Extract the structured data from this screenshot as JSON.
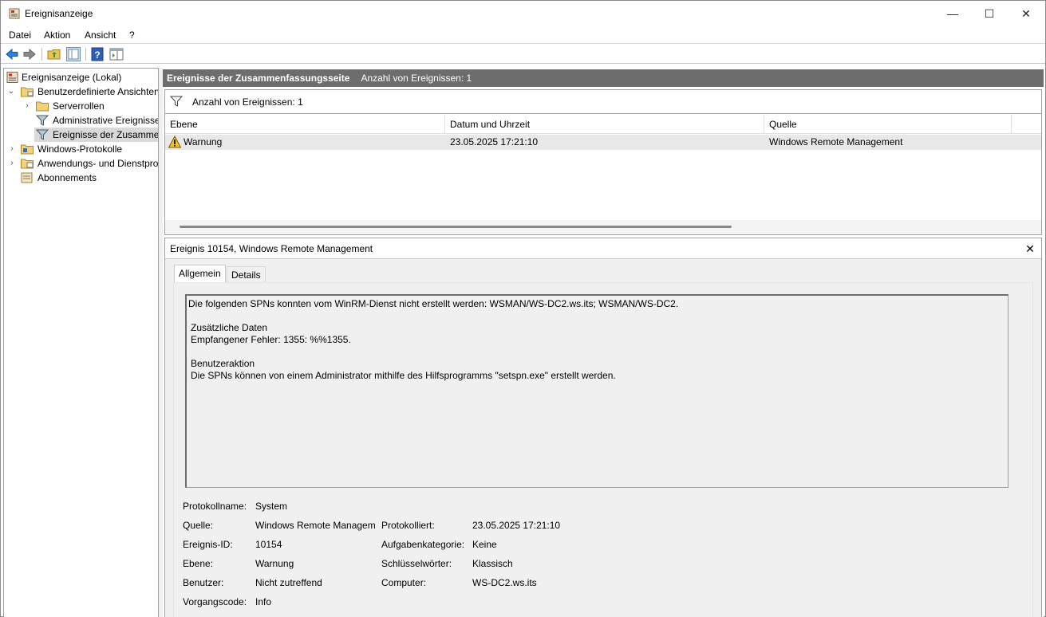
{
  "window": {
    "title": "Ereignisanzeige",
    "controls": {
      "minimize": "—",
      "maximize": "☐",
      "close": "✕"
    }
  },
  "menu": [
    "Datei",
    "Aktion",
    "Ansicht",
    "?"
  ],
  "toolbar": {
    "icons": [
      "back-arrow-icon",
      "forward-arrow-icon",
      "folder-up-icon",
      "show-hide-tree-icon",
      "help-icon",
      "show-action-pane-icon"
    ]
  },
  "tree": {
    "items": [
      {
        "label": "Ereignisanzeige (Lokal)"
      },
      {
        "label": "Benutzerdefinierte Ansichten"
      },
      {
        "label": "Serverrollen"
      },
      {
        "label": "Administrative Ereignisse"
      },
      {
        "label": "Ereignisse der Zusammenfassungsseite"
      },
      {
        "label": "Windows-Protokolle"
      },
      {
        "label": "Anwendungs- und Dienstprotokolle"
      },
      {
        "label": "Abonnements"
      }
    ]
  },
  "summary": {
    "title": "Ereignisse der Zusammenfassungsseite",
    "count": "Anzahl von Ereignissen: 1"
  },
  "filter": {
    "text": "Anzahl von Ereignissen: 1"
  },
  "grid": {
    "columns": [
      "Ebene",
      "Datum und Uhrzeit",
      "Quelle"
    ],
    "rows": [
      {
        "level": "Warnung",
        "datetime": "23.05.2025 17:21:10",
        "source": "Windows Remote Management"
      }
    ]
  },
  "detail": {
    "title": "Ereignis 10154, Windows Remote Management",
    "close": "✕",
    "tabs": [
      "Allgemein",
      "Details"
    ],
    "message": {
      "line1": "Die folgenden SPNs konnten vom WinRM-Dienst nicht erstellt werden: WSMAN/WS-DC2.ws.its; WSMAN/WS-DC2.",
      "line3": "Zusätzliche Daten",
      "line4": "Empfangener Fehler: 1355: %%1355.",
      "line6": "Benutzeraktion",
      "line7": "Die SPNs können von einem Administrator mithilfe des Hilfsprogramms \"setspn.exe\" erstellt werden."
    },
    "properties": {
      "log_name_label": "Protokollname:",
      "log_name": "System",
      "source_label": "Quelle:",
      "source": "Windows Remote Managem",
      "logged_label": "Protokolliert:",
      "logged": "23.05.2025 17:21:10",
      "event_id_label": "Ereignis-ID:",
      "event_id": "10154",
      "task_label": "Aufgabenkategorie:",
      "task": "Keine",
      "level_label": "Ebene:",
      "level": "Warnung",
      "keywords_label": "Schlüsselwörter:",
      "keywords": "Klassisch",
      "user_label": "Benutzer:",
      "user": "Nicht zutreffend",
      "computer_label": "Computer:",
      "computer": "WS-DC2.ws.its",
      "opcode_label": "Vorgangscode:",
      "opcode": "Info"
    }
  }
}
